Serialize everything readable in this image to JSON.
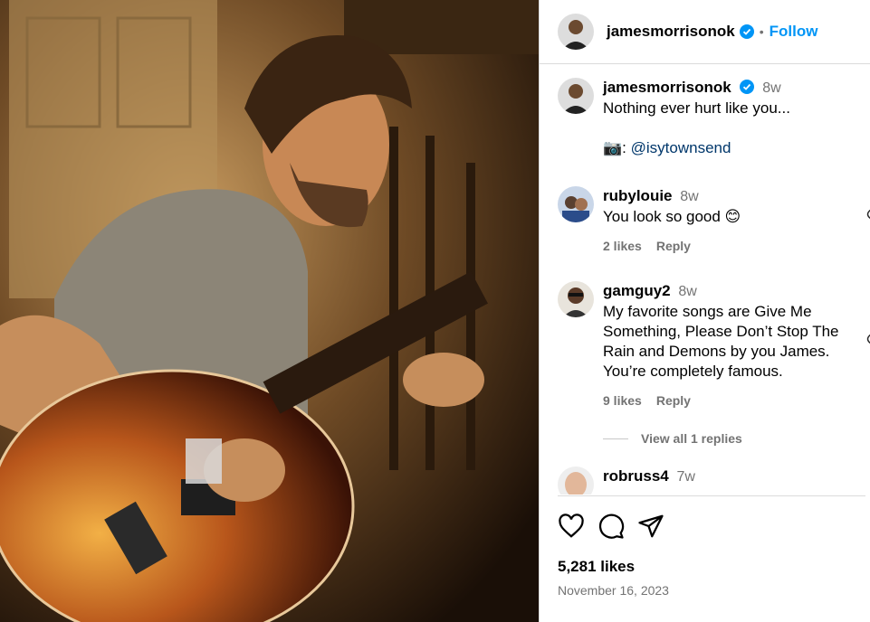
{
  "post": {
    "author": "jamesmorrisonok",
    "follow_label": "Follow",
    "dot": "•",
    "caption_time": "8w",
    "caption_line1": "Nothing ever hurt like you...",
    "caption_camera": "📷",
    "caption_credit_prefix": ":",
    "caption_mention": "@isytownsend",
    "likes": "5,281 likes",
    "date": "November 16, 2023"
  },
  "comments": [
    {
      "user": "rubylouie",
      "time": "8w",
      "text": "You look so good 😊",
      "likes": "2 likes",
      "reply": "Reply"
    },
    {
      "user": "gamguy2",
      "time": "8w",
      "text": "My favorite songs are Give Me Something, Please Don’t Stop The Rain and Demons by you James. You’re completely famous.",
      "likes": "9 likes",
      "reply": "Reply"
    },
    {
      "user": "robruss4",
      "time": "7w",
      "text": ""
    }
  ],
  "view_replies": "View all 1 replies",
  "icons": {
    "like": "heart-icon",
    "comment": "comment-icon",
    "share": "share-icon",
    "verified": "verified-badge-icon"
  },
  "colors": {
    "follow": "#0095f6",
    "verified": "#0095f6",
    "muted": "#737373"
  }
}
